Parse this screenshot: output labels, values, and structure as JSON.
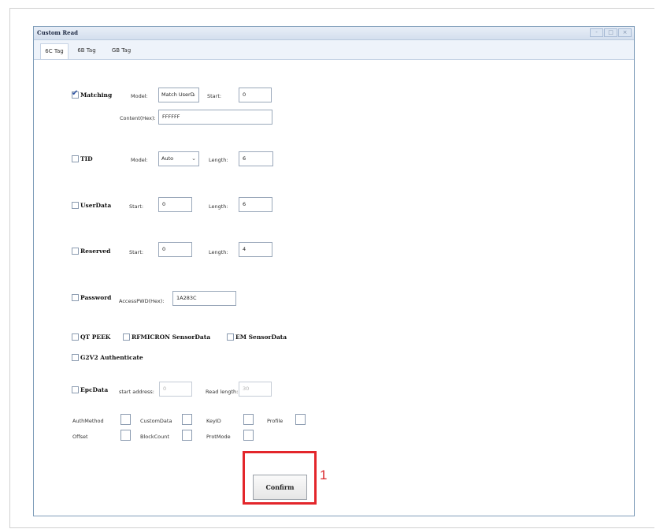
{
  "window": {
    "title": "Custom Read",
    "controls": [
      "-",
      "□",
      "×"
    ]
  },
  "tabs": [
    {
      "label": "6C Tag",
      "active": true
    },
    {
      "label": "6B Tag",
      "active": false
    },
    {
      "label": "GB Tag",
      "active": false
    }
  ],
  "matching": {
    "checkbox_label": "Matching",
    "checked": true,
    "model_label": "Model:",
    "model_value": "Match UserD",
    "start_label": "Start:",
    "start_value": "0",
    "content_label": "Content(Hex):",
    "content_value": "FFFFFF"
  },
  "tid": {
    "checkbox_label": "TID",
    "checked": false,
    "model_label": "Model:",
    "model_value": "Auto",
    "length_label": "Length:",
    "length_value": "6"
  },
  "userdata": {
    "checkbox_label": "UserData",
    "checked": false,
    "start_label": "Start:",
    "start_value": "0",
    "length_label": "Length:",
    "length_value": "6"
  },
  "reserved": {
    "checkbox_label": "Reserved",
    "checked": false,
    "start_label": "Start:",
    "start_value": "0",
    "length_label": "Length:",
    "length_value": "4"
  },
  "password": {
    "checkbox_label": "Password",
    "checked": false,
    "access_label": "AccessPWD(Hex):",
    "access_value": "1A283C"
  },
  "options": {
    "qt_peek": "QT PEEK",
    "rfmicron": "RFMICRON SensorData",
    "em": "EM SensorData",
    "g2v2": "G2V2 Authenticate"
  },
  "epcdata": {
    "checkbox_label": "EpcData",
    "checked": false,
    "start_label": "start address:",
    "start_value": "0",
    "read_label": "Read length:",
    "read_value": "30"
  },
  "auth_fields": {
    "row1": [
      "AuthMethod",
      "CustomData",
      "KeyID",
      "Profile"
    ],
    "row2": [
      "Offset",
      "BlockCount",
      "ProtMode"
    ]
  },
  "confirm_label": "Confirm",
  "annotation_number": "1",
  "colors": {
    "highlight": "#e3262b",
    "check_mark": "#2a4fa0",
    "window_border": "#7f9db9"
  }
}
